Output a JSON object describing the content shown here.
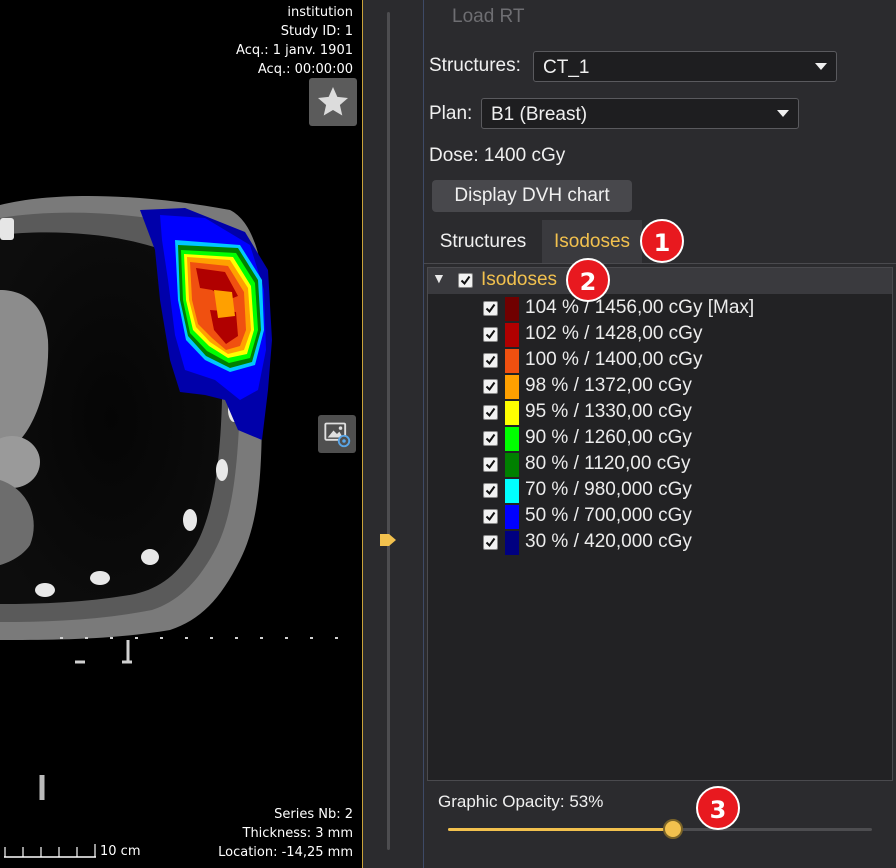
{
  "viewer": {
    "overlay_top_right": [
      "institution",
      "Study ID: 1",
      "Acq.: 1 janv. 1901",
      "Acq.: 00:00:00"
    ],
    "overlay_bottom_right": [
      "Series Nb: 2",
      "Thickness: 3 mm",
      "Location: -14,25 mm"
    ],
    "scale_label": "10 cm",
    "star_icon": "star-icon",
    "image_settings_icon": "image-settings-icon"
  },
  "panel": {
    "load_rt_label": "Load RT",
    "structures_label": "Structures:",
    "structures_value": "CT_1",
    "plan_label": "Plan:",
    "plan_value": "B1 (Breast)",
    "dose_text": "Dose: 1400 cGy",
    "dvh_button": "Display DVH chart",
    "tabs": [
      {
        "label": "Structures",
        "active": false
      },
      {
        "label": "Isodoses",
        "active": true
      }
    ],
    "tree_root": {
      "label": "Isodoses",
      "checked": true
    },
    "isodoses": [
      {
        "label": "104 % / 1456,00 cGy [Max]",
        "color": "#700000",
        "checked": true
      },
      {
        "label": "102 % / 1428,00 cGy",
        "color": "#b00000",
        "checked": true
      },
      {
        "label": "100 % / 1400,00 cGy",
        "color": "#f05010",
        "checked": true
      },
      {
        "label": "98 % / 1372,00 cGy",
        "color": "#ffa000",
        "checked": true
      },
      {
        "label": "95 % / 1330,00 cGy",
        "color": "#ffff00",
        "checked": true
      },
      {
        "label": "90 % / 1260,00 cGy",
        "color": "#00ff00",
        "checked": true
      },
      {
        "label": "80 % / 1120,00 cGy",
        "color": "#008000",
        "checked": true
      },
      {
        "label": "70 % / 980,000 cGy",
        "color": "#00ffff",
        "checked": true
      },
      {
        "label": "50 % / 700,000 cGy",
        "color": "#0000ff",
        "checked": true
      },
      {
        "label": "30 % / 420,000 cGy",
        "color": "#000080",
        "checked": true
      }
    ],
    "opacity_label": "Graphic Opacity: 53%",
    "opacity_value": 0.53,
    "accent_color": "#f2c14e"
  },
  "badges": [
    "1",
    "2",
    "3"
  ]
}
